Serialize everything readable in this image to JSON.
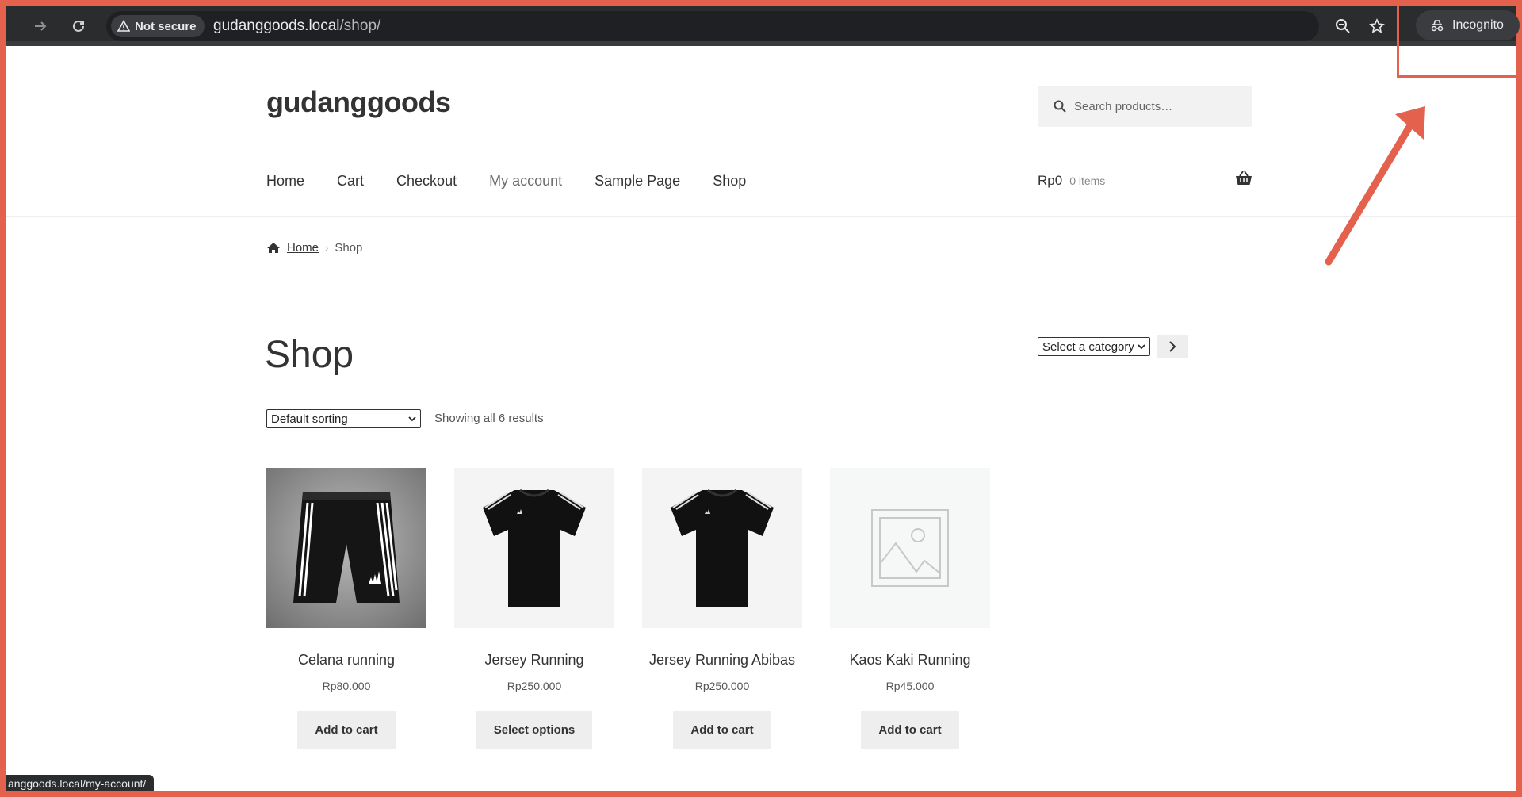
{
  "browser": {
    "security_label": "Not secure",
    "url_host": "gudanggoods.local",
    "url_path": "/shop/",
    "incognito_label": "Incognito",
    "status_url": "anggoods.local/my-account/"
  },
  "site": {
    "title": "gudanggoods",
    "search_placeholder": "Search products…"
  },
  "menu": {
    "items": [
      "Home",
      "Cart",
      "Checkout",
      "My account",
      "Sample Page",
      "Shop"
    ]
  },
  "cart": {
    "total": "Rp0",
    "items": "0 items"
  },
  "breadcrumb": {
    "home": "Home",
    "current": "Shop"
  },
  "shop": {
    "title": "Shop",
    "sorting": "Default sorting",
    "results": "Showing all 6 results",
    "category_select": "Select a category"
  },
  "products": [
    {
      "name": "Celana running",
      "price": "Rp80.000",
      "button": "Add to cart"
    },
    {
      "name": "Jersey Running",
      "price": "Rp250.000",
      "button": "Select options"
    },
    {
      "name": "Jersey Running Abibas",
      "price": "Rp250.000",
      "button": "Add to cart"
    },
    {
      "name": "Kaos Kaki Running",
      "price": "Rp45.000",
      "button": "Add to cart"
    }
  ],
  "colors": {
    "frame": "#e3614d",
    "chrome": "#2b2c2e",
    "button_bg": "#eeeeee"
  }
}
